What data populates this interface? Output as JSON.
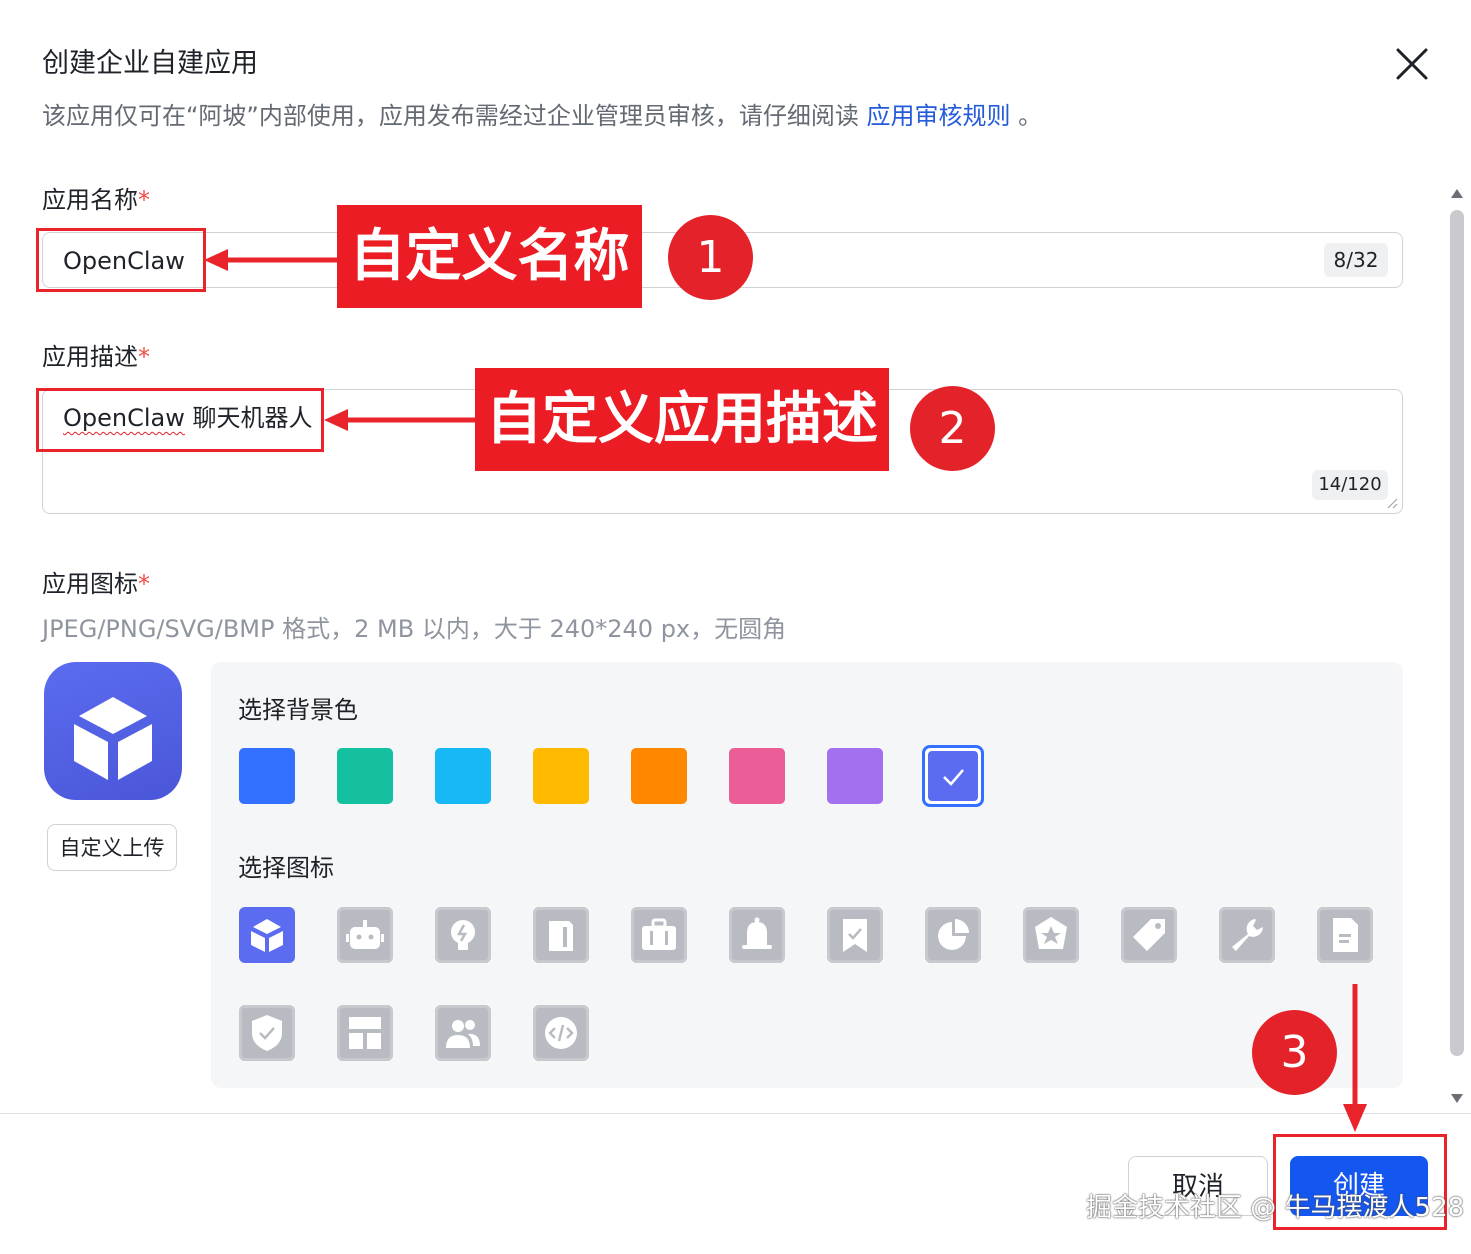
{
  "dialog": {
    "title": "创建企业自建应用",
    "subtitle_text": "该应用仅可在“阿坡”内部使用，应用发布需经过企业管理员审核，请仔细阅读",
    "subtitle_link": "应用审核规则",
    "subtitle_end": "。"
  },
  "form": {
    "name": {
      "label": "应用名称",
      "required_mark": "*",
      "value": "OpenClaw",
      "counter": "8/32"
    },
    "description": {
      "label": "应用描述",
      "required_mark": "*",
      "value_word": "OpenClaw",
      "value_rest": " 聊天机器人",
      "counter": "14/120"
    },
    "icon": {
      "label": "应用图标",
      "required_mark": "*",
      "hint": "JPEG/PNG/SVG/BMP 格式，2 MB 以内，大于 240*240 px，无圆角",
      "upload_label": "自定义上传",
      "bg_label": "选择背景色",
      "bg_colors": [
        "#3370ff",
        "#14c0a0",
        "#16b9f5",
        "#ffba00",
        "#ff8800",
        "#ea5d96",
        "#a370f0",
        "#5b6cf0"
      ],
      "selected_bg": 7,
      "icon_label": "选择图标",
      "icons": [
        "cube-icon",
        "robot-icon",
        "lightbulb-icon",
        "book-icon",
        "briefcase-icon",
        "bell-icon",
        "bookmark-icon",
        "pie-chart-icon",
        "star-badge-icon",
        "tag-icon",
        "wrench-icon",
        "document-icon",
        "shield-icon",
        "layout-icon",
        "users-icon",
        "code-icon"
      ],
      "selected_icon": 0
    }
  },
  "footer": {
    "cancel_label": "取消",
    "create_label": "创建"
  },
  "annotations": {
    "callout_1": "自定义名称",
    "callout_2": "自定义应用描述",
    "step_1": "1",
    "step_2": "2",
    "step_3": "3"
  },
  "watermark": "掘金技术社区 @ 牛马摆渡人528"
}
